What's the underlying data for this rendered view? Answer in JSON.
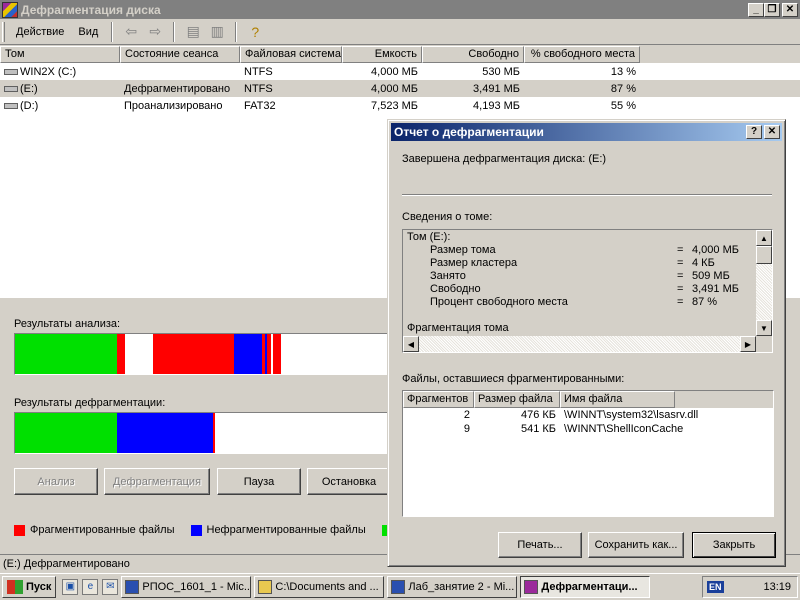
{
  "window": {
    "title": "Дефрагментация диска"
  },
  "menu": {
    "action": "Действие",
    "view": "Вид"
  },
  "table": {
    "headers": [
      "Том",
      "Состояние сеанса",
      "Файловая система",
      "Емкость",
      "Свободно",
      "% свободного места"
    ],
    "rows": [
      {
        "vol": "WIN2X (C:)",
        "state": "",
        "fs": "NTFS",
        "cap": "4,000 МБ",
        "free": "530 МБ",
        "pct": "13 %"
      },
      {
        "vol": "(E:)",
        "state": "Дефрагментировано",
        "fs": "NTFS",
        "cap": "4,000 МБ",
        "free": "3,491 МБ",
        "pct": "87 %"
      },
      {
        "vol": "(D:)",
        "state": "Проанализировано",
        "fs": "FAT32",
        "cap": "7,523 МБ",
        "free": "4,193 МБ",
        "pct": "55 %"
      }
    ]
  },
  "panel": {
    "analysis_label": "Результаты анализа:",
    "defrag_label": "Результаты дефрагментации:",
    "buttons": {
      "analyze": "Анализ",
      "defrag": "Дефрагментация",
      "pause": "Пауза",
      "stop": "Остановка"
    },
    "legend": {
      "fragmented": "Фрагментированные файлы",
      "contiguous": "Нефрагментированные файлы"
    }
  },
  "colors": {
    "fragmented": "#ff0000",
    "contiguous": "#0000ff",
    "system": "#00c000",
    "free": "#ffffff"
  },
  "status": "(E:) Дефрагментировано",
  "taskbar": {
    "start": "Пуск",
    "tasks": [
      "РПОС_1601_1 - Mic...",
      "C:\\Documents and ...",
      "Лаб_занятие 2 - Mi...",
      "Дефрагментаци..."
    ],
    "lang": "EN",
    "clock": "13:19"
  },
  "dialog": {
    "title": "Отчет о дефрагментации",
    "done": "Завершена дефрагментация диска: (E:)",
    "info_label": "Сведения о томе:",
    "info_title": "Том (E:):",
    "info": [
      {
        "k": "Размер тома",
        "v": "4,000 МБ"
      },
      {
        "k": "Размер кластера",
        "v": "4 КБ"
      },
      {
        "k": "Занято",
        "v": "509 МБ"
      },
      {
        "k": "Свободно",
        "v": "3,491 МБ"
      },
      {
        "k": "Процент свободного места",
        "v": "87 %"
      }
    ],
    "info_more": "Фрагментация тома",
    "files_label": "Файлы, оставшиеся фрагментированными:",
    "files_headers": [
      "Фрагментов",
      "Размер файла",
      "Имя файла"
    ],
    "files": [
      {
        "frag": "2",
        "size": "476 КБ",
        "name": "\\WINNT\\system32\\lsasrv.dll"
      },
      {
        "frag": "9",
        "size": "541 КБ",
        "name": "\\WINNT\\ShellIconCache"
      }
    ],
    "buttons": {
      "print": "Печать...",
      "save": "Сохранить как...",
      "close": "Закрыть"
    }
  }
}
